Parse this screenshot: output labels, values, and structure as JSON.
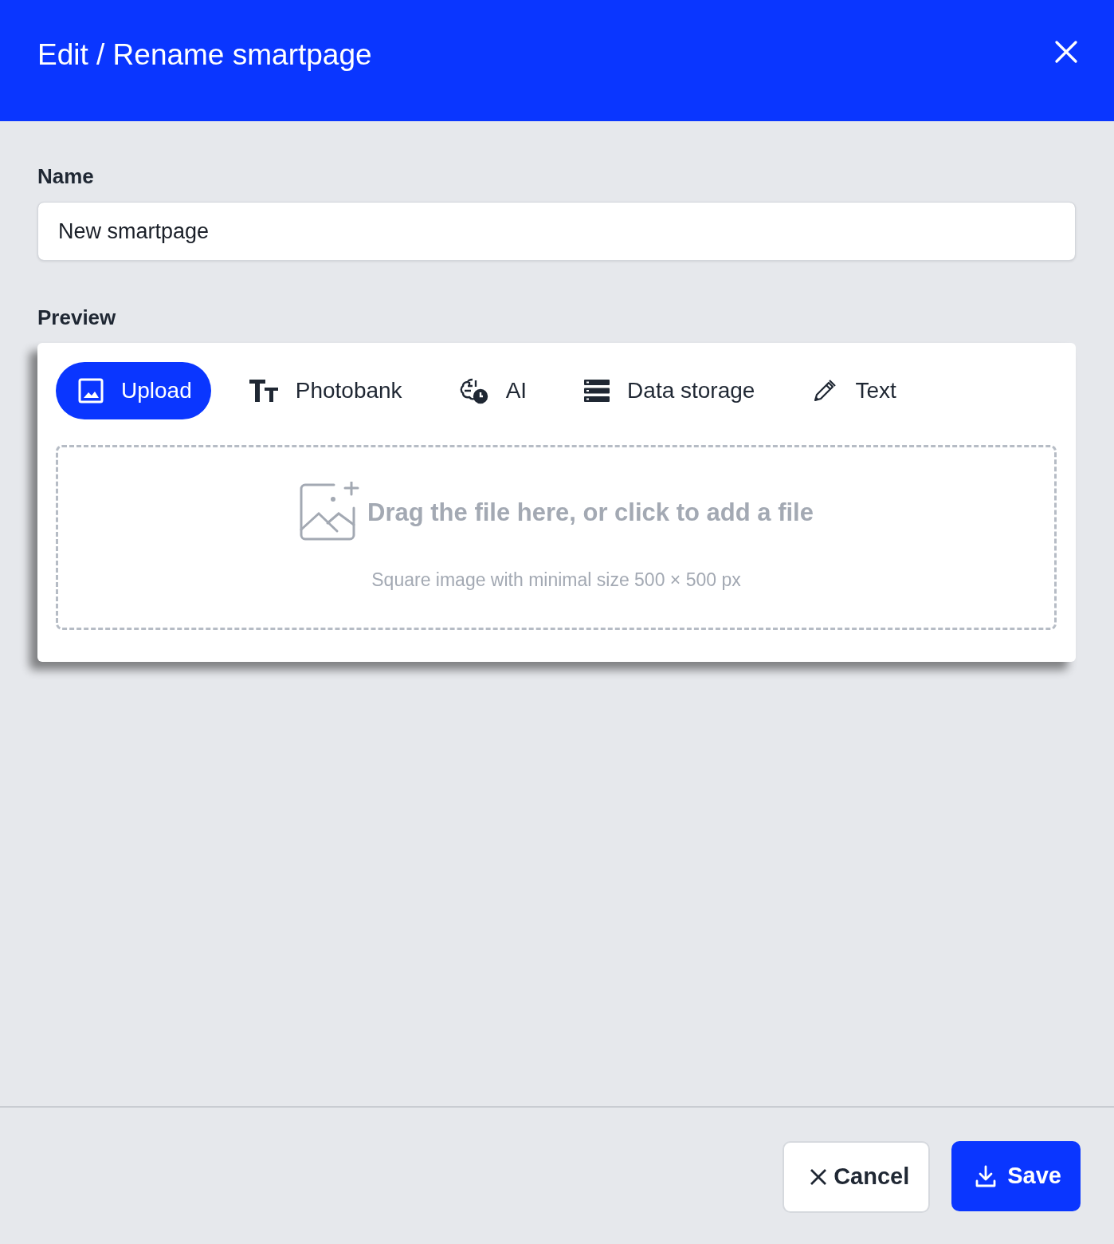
{
  "dialog": {
    "title": "Edit / Rename smartpage"
  },
  "name_field": {
    "label": "Name",
    "value": "New smartpage"
  },
  "preview": {
    "label": "Preview",
    "tabs": [
      {
        "label": "Upload",
        "selected": true
      },
      {
        "label": "Photobank",
        "selected": false
      },
      {
        "label": "AI",
        "selected": false
      },
      {
        "label": "Data storage",
        "selected": false
      },
      {
        "label": "Text",
        "selected": false
      }
    ],
    "dropzone": {
      "prompt": "Drag the file here, or click to add a file",
      "hint": "Square image with minimal size 500 × 500 px"
    }
  },
  "buttons": [
    {
      "kind": "cancel",
      "label": "Cancel"
    },
    {
      "kind": "save",
      "label": "Save"
    }
  ]
}
